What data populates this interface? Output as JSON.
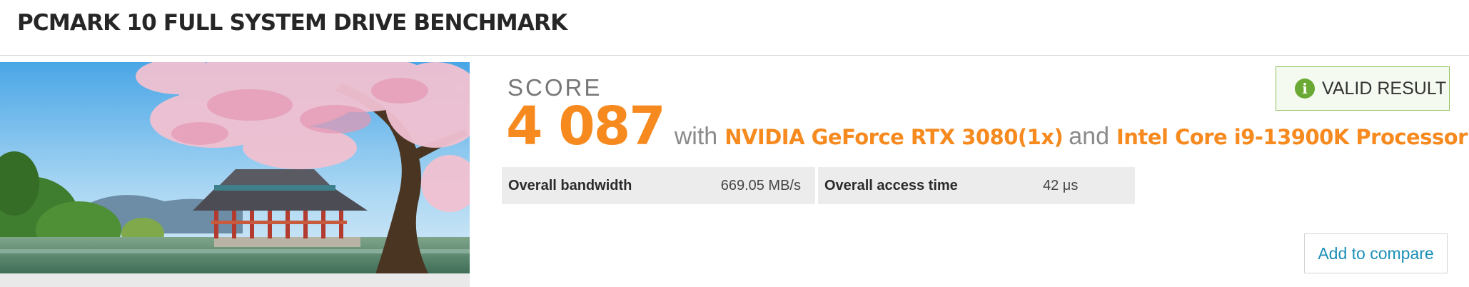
{
  "header": {
    "title": "PCMARK 10 FULL SYSTEM DRIVE BENCHMARK"
  },
  "result": {
    "score_label": "SCORE",
    "score_value": "4 087",
    "with_word": "with",
    "gpu": "NVIDIA GeForce RTX 3080(1x)",
    "and_word": "and",
    "cpu": "Intel Core i9-13900K Processor"
  },
  "badge": {
    "label": "VALID RESULT",
    "icon": "info-icon",
    "color": "#6aa934"
  },
  "stats": [
    {
      "label": "Overall bandwidth",
      "value": "669.05 MB/s"
    },
    {
      "label": "Overall access time",
      "value": "42 μs"
    }
  ],
  "actions": {
    "compare_label": "Add to compare"
  },
  "colors": {
    "accent": "#f68a1f",
    "link": "#1a8fb5",
    "valid": "#6aa934"
  }
}
